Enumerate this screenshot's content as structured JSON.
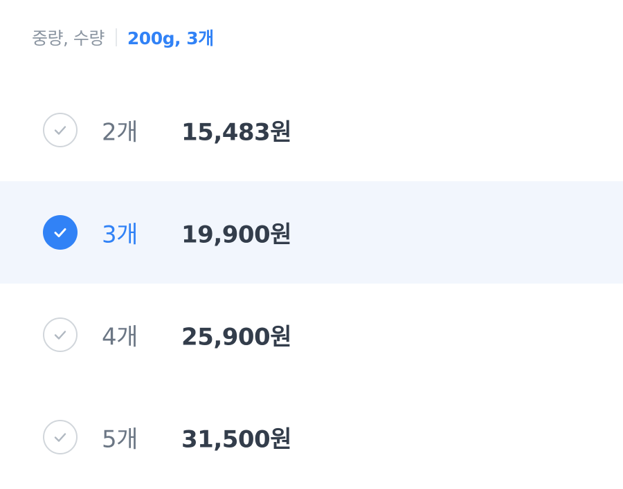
{
  "header": {
    "label": "중량, 수량",
    "value": "200g, 3개"
  },
  "options": [
    {
      "qty": "2개",
      "price": "15,483원",
      "selected": false
    },
    {
      "qty": "3개",
      "price": "19,900원",
      "selected": true
    },
    {
      "qty": "4개",
      "price": "25,900원",
      "selected": false
    },
    {
      "qty": "5개",
      "price": "31,500원",
      "selected": false
    }
  ],
  "icons": {
    "check": "check-icon"
  },
  "colors": {
    "accent": "#3182f6",
    "selected_row_bg": "#f2f6fd",
    "unchecked_border": "#d1d6db",
    "muted_text": "#8b95a1",
    "qty_text": "#6b7684",
    "price_text": "#333d4b"
  }
}
